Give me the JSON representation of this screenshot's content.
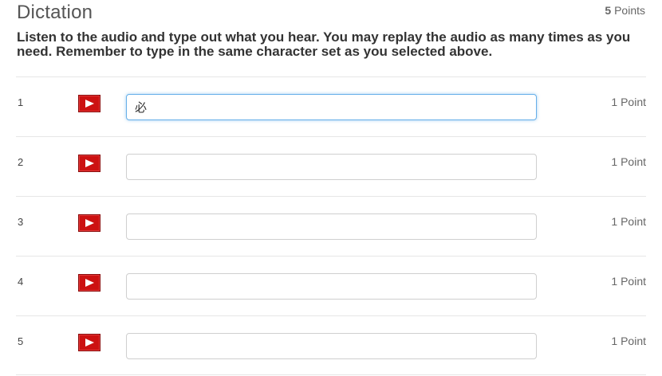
{
  "header": {
    "title": "Dictation",
    "points_number": "5",
    "points_label": "Points"
  },
  "instructions": "Listen to the audio and type out what you hear. You may replay the audio as many times as you need. Remember to type in the same character set as you selected above.",
  "items": [
    {
      "number": "1",
      "value": "必",
      "points": "1 Point",
      "play_icon": "play-icon"
    },
    {
      "number": "2",
      "value": "",
      "points": "1 Point",
      "play_icon": "play-icon"
    },
    {
      "number": "3",
      "value": "",
      "points": "1 Point",
      "play_icon": "play-icon"
    },
    {
      "number": "4",
      "value": "",
      "points": "1 Point",
      "play_icon": "play-icon"
    },
    {
      "number": "5",
      "value": "",
      "points": "1 Point",
      "play_icon": "play-icon"
    }
  ],
  "colors": {
    "play_button": "#cc1111",
    "focus_border": "#66afe9"
  }
}
